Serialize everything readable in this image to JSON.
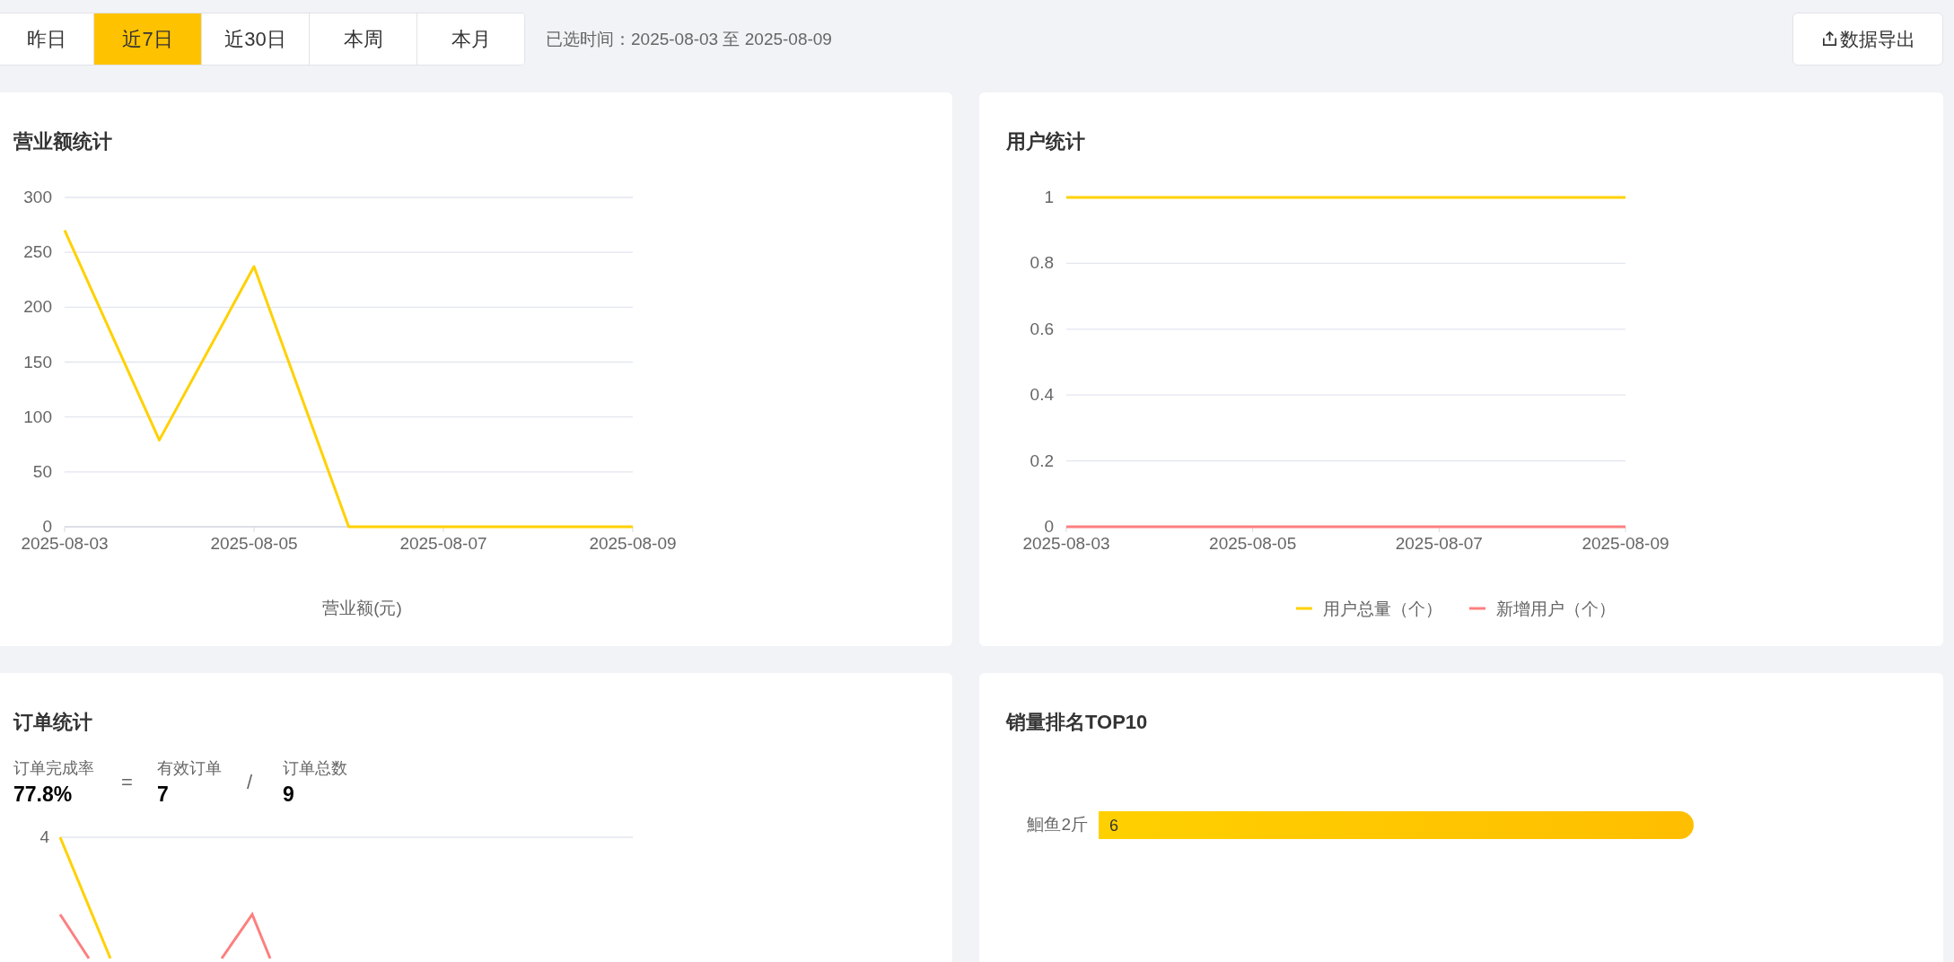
{
  "toolbar": {
    "tabs": [
      {
        "label": "昨日",
        "selected": false
      },
      {
        "label": "近7日",
        "selected": true
      },
      {
        "label": "近30日",
        "selected": false
      },
      {
        "label": "本周",
        "selected": false
      },
      {
        "label": "本月",
        "selected": false
      }
    ],
    "date_range": "已选时间：2025-08-03 至 2025-08-09",
    "export_button": "数据导出"
  },
  "revenue": {
    "title": "营业额统计",
    "chart_data": {
      "type": "line",
      "xlabel": "营业额(元)",
      "categories": [
        "2025-08-03",
        null,
        "2025-08-05",
        null,
        "2025-08-07",
        null,
        "2025-08-09"
      ],
      "series": [
        {
          "color": "#ffd100",
          "values": [
            270,
            79,
            237,
            0,
            0,
            0,
            0
          ]
        }
      ],
      "ylim": [
        0,
        300
      ],
      "yticks": [
        0,
        50,
        100,
        150,
        200,
        250,
        300
      ],
      "grid": true
    }
  },
  "users": {
    "title": "用户统计",
    "chart_data": {
      "type": "line",
      "series": [
        {
          "name": "用户总量（个）",
          "color": "#ffd100",
          "values": [
            1,
            1,
            1,
            1,
            1,
            1,
            1
          ]
        },
        {
          "name": "新增用户（个）",
          "color": "#fd7f7f",
          "values": [
            0,
            0,
            0,
            0,
            0,
            0,
            0
          ]
        }
      ],
      "categories": [
        "2025-08-03",
        null,
        "2025-08-05",
        null,
        "2025-08-07",
        null,
        "2025-08-09"
      ],
      "ylim": [
        0,
        1
      ],
      "yticks": [
        0,
        0.2,
        0.4,
        0.6,
        0.8,
        1
      ],
      "grid": true,
      "legend": true
    }
  },
  "orders": {
    "title": "订单统计",
    "stats": [
      {
        "label": "订单完成率",
        "value": "77.8%"
      },
      {
        "label": "有效订单",
        "value": "7"
      },
      {
        "label": "订单总数",
        "value": "9"
      }
    ],
    "operators": [
      "=",
      "/"
    ],
    "chart": {
      "tick_label": "4"
    }
  },
  "top_sales": {
    "title": "销量排名TOP10",
    "chart_data": {
      "type": "bar",
      "orientation": "horizontal",
      "categories": [
        "鮰鱼2斤"
      ],
      "values": [
        6
      ],
      "data_labels": true
    }
  }
}
